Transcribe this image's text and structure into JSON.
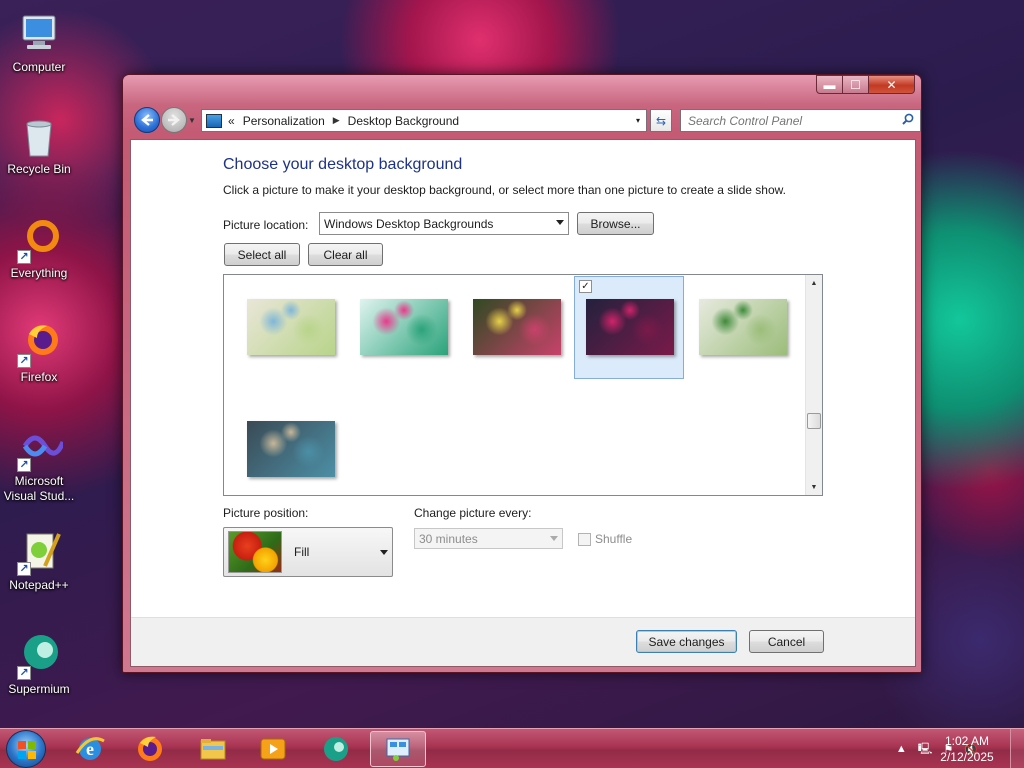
{
  "desktop": {
    "icons": [
      {
        "label": "Computer"
      },
      {
        "label": "Recycle Bin"
      },
      {
        "label": "Everything"
      },
      {
        "label": "Firefox"
      },
      {
        "label": "Microsoft Visual Stud..."
      },
      {
        "label": "Notepad++"
      },
      {
        "label": "Supermium"
      }
    ]
  },
  "window": {
    "caption_buttons": {
      "minimize": "▬",
      "maximize": "☐",
      "close": "✕"
    },
    "address": {
      "prefix": "«",
      "crumbs": [
        "Personalization",
        "Desktop Background"
      ],
      "separator": "▶",
      "dropdown": "▾"
    },
    "refresh_glyph": "⇆",
    "search": {
      "placeholder": "Search Control Panel"
    },
    "heading": "Choose your desktop background",
    "description": "Click a picture to make it your desktop background, or select more than one picture to create a slide show.",
    "picture_location": {
      "label": "Picture location:",
      "value": "Windows Desktop Backgrounds"
    },
    "browse_label": "Browse...",
    "select_all_label": "Select all",
    "clear_all_label": "Clear all",
    "thumbnails": [
      {
        "selected": false,
        "colors": [
          "#e9e6d8",
          "#7fb6d9",
          "#b8d48a"
        ]
      },
      {
        "selected": false,
        "colors": [
          "#dff3ef",
          "#e73a8b",
          "#2aa37a"
        ]
      },
      {
        "selected": false,
        "colors": [
          "#2f4a22",
          "#e8d24a",
          "#c8426a"
        ]
      },
      {
        "selected": true,
        "colors": [
          "#23213d",
          "#d1236a",
          "#7a1a4a"
        ],
        "checkmark": "✓"
      },
      {
        "selected": false,
        "colors": [
          "#e7eadf",
          "#3f8a3a",
          "#9bbd7a"
        ]
      },
      {
        "selected": false,
        "colors": [
          "#3a4a55",
          "#c7b79a",
          "#4c8fa6"
        ]
      }
    ],
    "picture_position": {
      "label": "Picture position:",
      "value": "Fill"
    },
    "change_picture": {
      "label": "Change picture every:",
      "value": "30 minutes"
    },
    "shuffle_label": "Shuffle",
    "save_label": "Save changes",
    "cancel_label": "Cancel"
  },
  "taskbar": {
    "apps": [
      {
        "name": "Internet Explorer",
        "active": false
      },
      {
        "name": "Firefox",
        "active": false
      },
      {
        "name": "File Explorer",
        "active": false
      },
      {
        "name": "Media Player",
        "active": false
      },
      {
        "name": "Supermium",
        "active": false
      },
      {
        "name": "Control Panel",
        "active": true
      }
    ],
    "tray_icons": [
      "▲",
      "🖳",
      "⚑",
      "🔇"
    ],
    "time": "1:02 AM",
    "date": "2/12/2025"
  },
  "colors": {
    "heading": "#1e3287",
    "selection": "#dbebfb",
    "window_frame": "#c45a74",
    "taskbar": "#a83452"
  }
}
